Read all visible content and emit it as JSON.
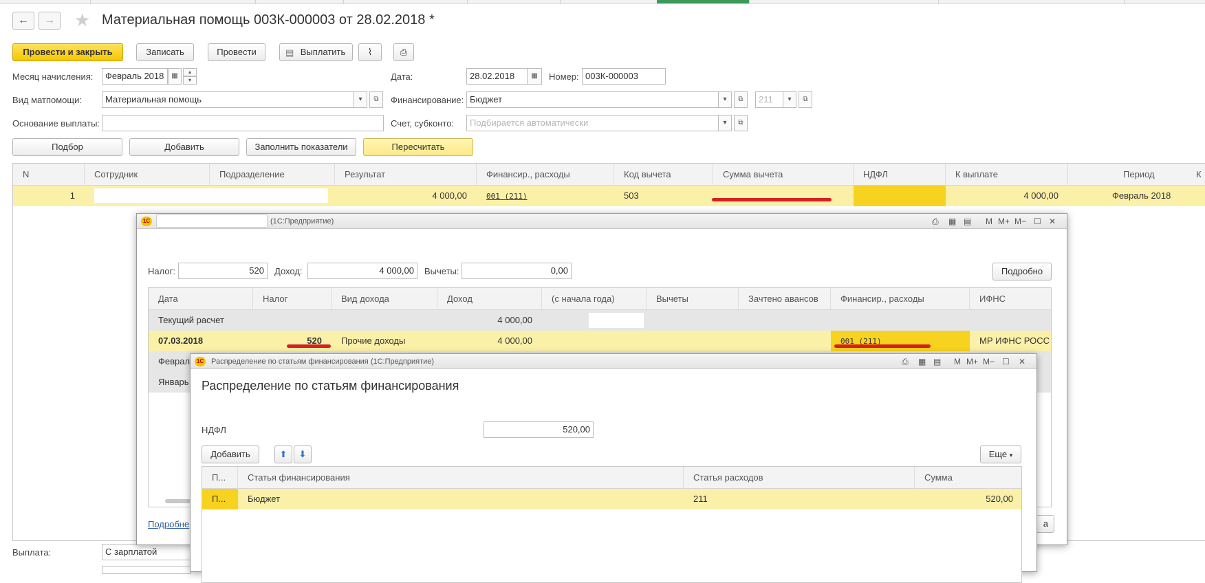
{
  "window": {
    "title": "Материальная помощь 003К-000003 от 28.02.2018 *"
  },
  "toolbar": {
    "post_close": "Провести и закрыть",
    "save": "Записать",
    "post": "Провести",
    "pay": "Выплатить"
  },
  "form": {
    "month_label": "Месяц начисления:",
    "month_value": "Февраль 2018",
    "date_label": "Дата:",
    "date_value": "28.02.2018",
    "number_label": "Номер:",
    "number_value": "003К-000003",
    "aid_type_label": "Вид матпомощи:",
    "aid_type_value": "Материальная помощь",
    "financing_label": "Финансирование:",
    "financing_value": "Бюджет",
    "financing_code": "211",
    "basis_label": "Основание выплаты:",
    "basis_value": "",
    "account_label": "Счет, субконто:",
    "account_placeholder": "Подбирается автоматически"
  },
  "actions": {
    "pick": "Подбор",
    "add": "Добавить",
    "fill": "Заполнить показатели",
    "recalc": "Пересчитать"
  },
  "main_table": {
    "columns": [
      "N",
      "Сотрудник",
      "Подразделение",
      "Результат",
      "Финансир., расходы",
      "Код вычета",
      "Сумма вычета",
      "НДФЛ",
      "К выплате",
      "Период",
      "К"
    ],
    "row": {
      "n": "1",
      "employee": "",
      "department": "",
      "result": "4 000,00",
      "financing": "001 (211)",
      "deduction_code": "503",
      "deduction_sum": "",
      "ndfl": "",
      "to_pay": "4 000,00",
      "period": "Февраль 2018"
    }
  },
  "bottom": {
    "payment_label": "Выплата:",
    "payment_value": "С зарплатой"
  },
  "ndfl_window": {
    "title_suffix": "(1С:Предприятие)",
    "tax_label": "Налог:",
    "tax_value": "520",
    "income_label": "Доход:",
    "income_value": "4 000,00",
    "deductions_label": "Вычеты:",
    "deductions_value": "0,00",
    "details_button": "Подробно",
    "columns": [
      "Дата",
      "Налог",
      "Вид дохода",
      "Доход",
      "(с начала года)",
      "Вычеты",
      "Зачтено авансов",
      "Финансир., расходы",
      "ИФНС"
    ],
    "row_current": {
      "date": "Текущий расчет",
      "income": "4 000,00"
    },
    "row_main": {
      "date": "07.03.2018",
      "tax": "520",
      "income_type": "Прочие доходы",
      "income": "4 000,00",
      "financing": "001 (211)",
      "ifns": "МР ИФНС РОСС"
    },
    "row_feb": "Феврал",
    "row_jan": "Январь",
    "details_link": "Подробне",
    "bottom_button_fragment": "а"
  },
  "distribution_window": {
    "title": "Распределение по статьям финансирования  (1С:Предприятие)",
    "heading": "Распределение по статьям финансирования",
    "ndfl_label": "НДФЛ",
    "ndfl_value": "520,00",
    "add_button": "Добавить",
    "more_button": "Еще",
    "columns": [
      "П...",
      "Статья финансирования",
      "Статья расходов",
      "Сумма"
    ],
    "row": {
      "p": "П...",
      "article": "Бюджет",
      "expense": "211",
      "sum": "520,00"
    }
  },
  "colors": {
    "primary_button": "#f6c700",
    "selected_row": "#fbf0a8",
    "highlight_cell": "#f7d21e",
    "underline_red": "#d62020"
  }
}
